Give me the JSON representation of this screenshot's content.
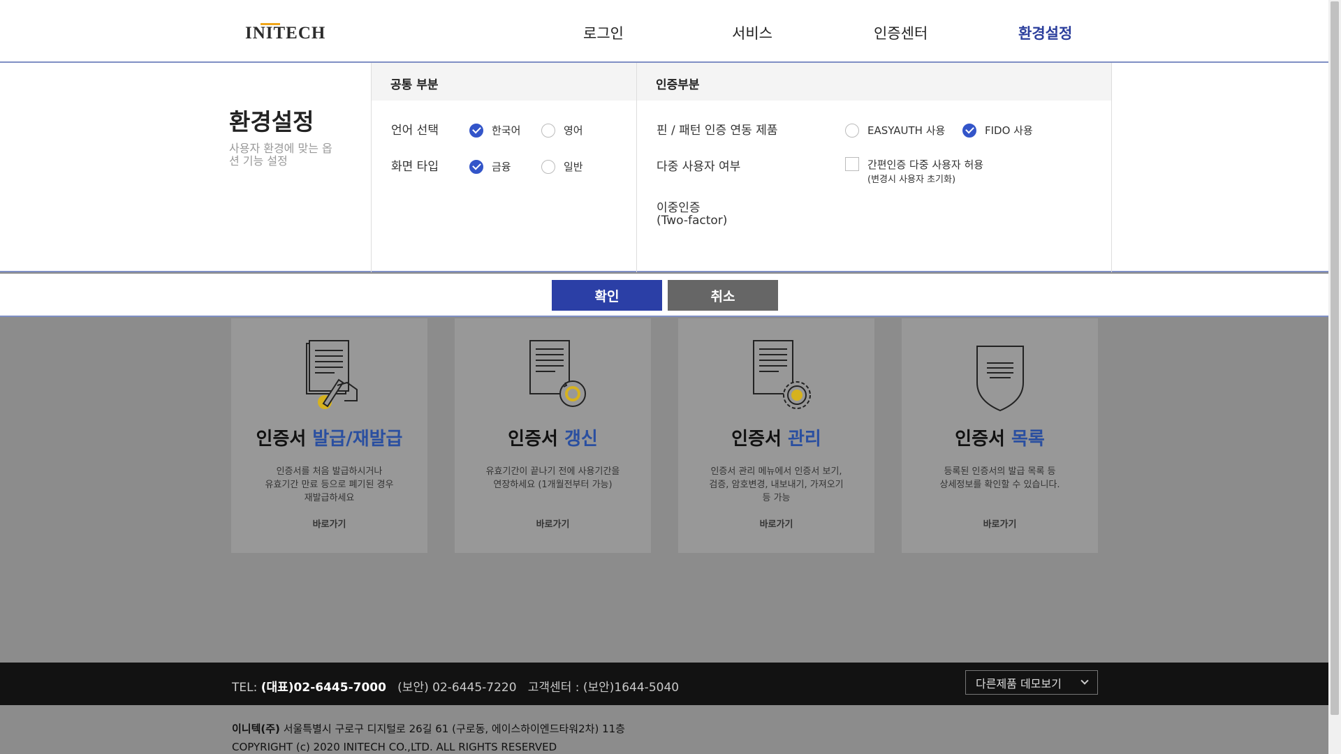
{
  "header": {
    "logo": "INITECH",
    "nav": [
      {
        "label": "로그인",
        "active": false
      },
      {
        "label": "서비스",
        "active": false
      },
      {
        "label": "인증센터",
        "active": false
      },
      {
        "label": "환경설정",
        "active": true
      }
    ]
  },
  "settings": {
    "title": "환경설정",
    "description": "사용자 환경에 맞는 옵션 기능 설정",
    "common": {
      "heading": "공통 부분",
      "language": {
        "label": "언어 선택",
        "options": [
          {
            "label": "한국어",
            "selected": true
          },
          {
            "label": "영어",
            "selected": false
          }
        ]
      },
      "screen_type": {
        "label": "화면 타입",
        "options": [
          {
            "label": "금융",
            "selected": true
          },
          {
            "label": "일반",
            "selected": false
          }
        ]
      }
    },
    "auth": {
      "heading": "인증부분",
      "pin_pattern": {
        "label": "핀 / 패턴 인증 연동 제품",
        "options": [
          {
            "label": "EASYAUTH 사용",
            "selected": false
          },
          {
            "label": "FIDO 사용",
            "selected": true
          }
        ]
      },
      "multi_user": {
        "label": "다중 사용자 여부",
        "checkbox_label": "간편인증 다중 사용자 허용",
        "checkbox_note": "(변경시 사용자 초기화)",
        "checked": false
      },
      "two_factor": {
        "label_line1": "이중인증",
        "label_line2": "(Two-factor)"
      }
    }
  },
  "buttons": {
    "confirm": "확인",
    "cancel": "취소"
  },
  "cards": [
    {
      "title_prefix": "인증서",
      "title_highlight": "발급/재발급",
      "desc": [
        "인증서를 처음 발급하시거나",
        "유효기간 만료 등으로 폐기된 경우",
        "재발급하세요"
      ],
      "link": "바로가기",
      "icon": "certificate-sign-icon"
    },
    {
      "title_prefix": "인증서",
      "title_highlight": "갱신",
      "desc": [
        "유효기간이 끝나기 전에 사용기간을",
        "연장하세요 (1개월전부터 가능)"
      ],
      "link": "바로가기",
      "icon": "certificate-renew-icon"
    },
    {
      "title_prefix": "인증서",
      "title_highlight": "관리",
      "desc": [
        "인증서 관리 메뉴에서 인증서 보기,",
        "검증, 암호변경, 내보내기, 가져오기",
        "등 가능"
      ],
      "link": "바로가기",
      "icon": "certificate-manage-icon"
    },
    {
      "title_prefix": "인증서",
      "title_highlight": "목록",
      "desc": [
        "등록된 인증서의 발급 목록 등",
        "상세정보를 확인할 수 있습니다."
      ],
      "link": "바로가기",
      "icon": "certificate-list-icon"
    }
  ],
  "footer": {
    "tel_label": "TEL:",
    "tel_main": "(대표)02-6445-7000",
    "tel_security": "(보안) 02-6445-7220",
    "customer_center": "고객센터 : (보안)1644-5040",
    "demo_select": "다른제품 데모보기",
    "company": "이니텍(주)",
    "address": "서울특별시 구로구 디지털로 26길 61 (구로동, 에이스하이엔드타워2차) 11층",
    "copyright": "COPYRIGHT (c) 2020 INITECH CO.,LTD. ALL RIGHTS RESERVED"
  },
  "colors": {
    "accent": "#2b3e9c",
    "confirm_button": "#2b3fa6",
    "cancel_button": "#666666",
    "card_highlight": "#2a4fa0",
    "icon_gold": "#d6b21e"
  }
}
